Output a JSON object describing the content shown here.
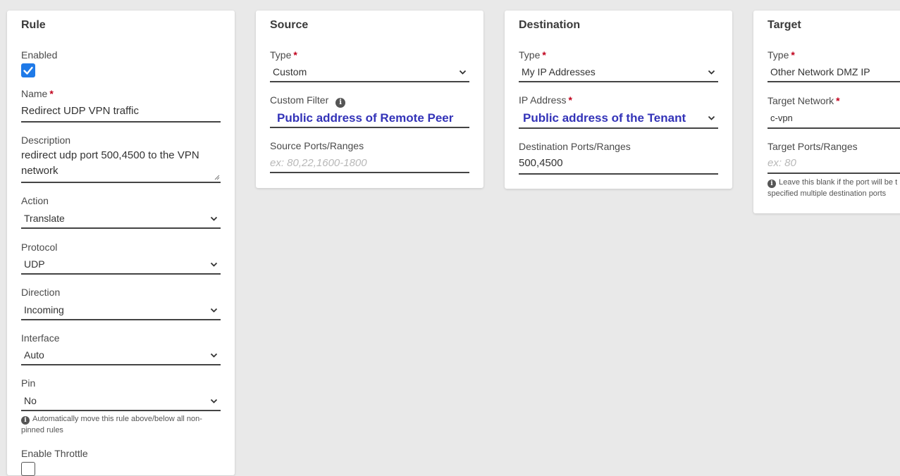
{
  "rule": {
    "title": "Rule",
    "enabled_label": "Enabled",
    "enabled_checked": true,
    "name_label": "Name",
    "name_value": "Redirect UDP VPN traffic",
    "description_label": "Description",
    "description_line1": "redirect udp port 500,4500 to the VPN",
    "description_line2": "network",
    "action_label": "Action",
    "action_value": "Translate",
    "protocol_label": "Protocol",
    "protocol_value": "UDP",
    "direction_label": "Direction",
    "direction_value": "Incoming",
    "interface_label": "Interface",
    "interface_value": "Auto",
    "pin_label": "Pin",
    "pin_value": "No",
    "pin_hint_line1": "Automatically move this rule above/below all non-",
    "pin_hint_line2": "pinned rules",
    "throttle_label": "Enable Throttle",
    "throttle_checked": false
  },
  "source": {
    "title": "Source",
    "type_label": "Type",
    "type_value": "Custom",
    "custom_filter_label": "Custom Filter",
    "custom_filter_value": "Public address of Remote Peer",
    "ports_label": "Source Ports/Ranges",
    "ports_placeholder": "ex: 80,22,1600-1800"
  },
  "destination": {
    "title": "Destination",
    "type_label": "Type",
    "type_value": "My IP Addresses",
    "ip_label": "IP Address",
    "ip_value": "Public address of the Tenant",
    "ports_label": "Destination Ports/Ranges",
    "ports_value": "500,4500"
  },
  "target": {
    "title": "Target",
    "type_label": "Type",
    "type_value": "Other Network DMZ IP",
    "network_label": "Target Network",
    "network_value": "c-vpn",
    "ports_label": "Target Ports/Ranges",
    "ports_placeholder": "ex: 80",
    "ports_hint_line1": "Leave this blank if the port will be t",
    "ports_hint_line2": "specified multiple destination ports"
  },
  "colors": {
    "accent": "#1f7ae8",
    "required": "#c0001b",
    "highlight_text": "#3333b8",
    "background": "#e9e9e9"
  }
}
